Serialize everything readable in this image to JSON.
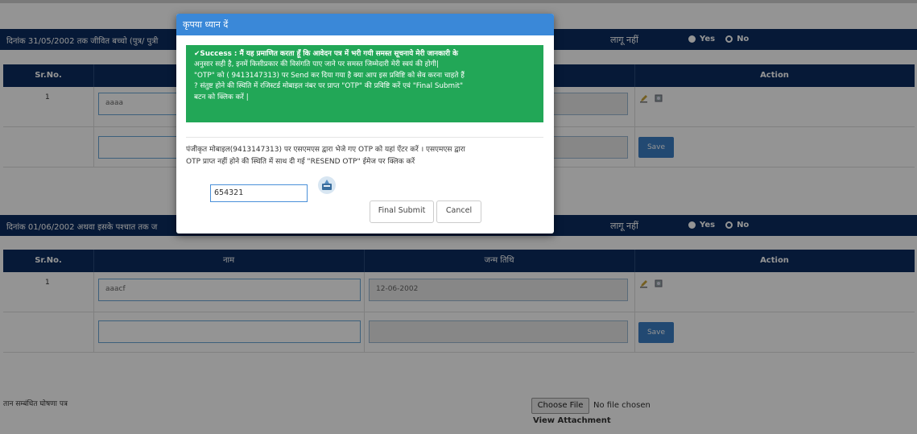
{
  "section1": {
    "label": "दिनांक 31/05/2002 तक जीवित बच्चो (पुत्र/ पुत्री",
    "lagu": "लागू नहीं",
    "yes": "Yes",
    "no": "No"
  },
  "table1": {
    "headers": [
      "Sr.No.",
      "",
      "",
      "Action"
    ],
    "rows": [
      {
        "sr": "1",
        "name": "aaaa"
      }
    ],
    "save": "Save"
  },
  "section2": {
    "label": "दिनांक 01/06/2002 अथवा इसके पश्चात तक ज",
    "lagu": "लागू नहीं",
    "yes": "Yes",
    "no": "No"
  },
  "table2": {
    "headers": [
      "Sr.No.",
      "नाम",
      "जन्म तिथि",
      "Action"
    ],
    "rows": [
      {
        "sr": "1",
        "name": "aaacf",
        "dob": "12-06-2002"
      }
    ],
    "save": "Save"
  },
  "bottom": {
    "label": "तान सम्बंधित घोषणा पत्र",
    "choose_file": "Choose File",
    "no_file": "No file chosen",
    "view_attachment": "View Attachment"
  },
  "modal": {
    "title": "कृपया ध्यान दें",
    "success_lines": [
      "✔Success : मैं यह प्रमाणित करता हूँ कि आवेदन पत्र में भरी गयी समस्त सूचनाये मेरी जानकारी के",
      "अनुसार सही है, इनमें किसीप्रकार की विसंगति पाए जाने पर समस्त जिम्मेदारी मेरी स्वयं की होगी|",
      "\"OTP\" को ( 9413147313) पर Send कर दिया गया है क्या आप इस प्रविष्टि को सेव करना चाहते हैं",
      "? संतुष्ट होने की स्थिति में रजिस्टर्ड मोबाइल नंबर पर प्राप्त \"OTP\" की प्रविष्टि करें एवं \"Final Submit\"",
      "बटन को क्लिक करें |"
    ],
    "otp_lines": [
      "पंजीकृत मोबाइल(9413147313) पर एसएमएस द्वारा भेजे गए OTP को यहां ऐंटर करें । एसएमएस द्वारा",
      "OTP प्राप्त नहीं होने की स्थिति में साथ दी गई \"RESEND OTP\" ईमेज पर क्लिक करें"
    ],
    "otp_value": "654321",
    "final_submit": "Final Submit",
    "cancel": "Cancel"
  },
  "colors": {
    "header_navy": "#0b2c5f",
    "modal_blue": "#3a88d8",
    "success_green": "#22a757",
    "save_blue": "#3b7ec4"
  }
}
